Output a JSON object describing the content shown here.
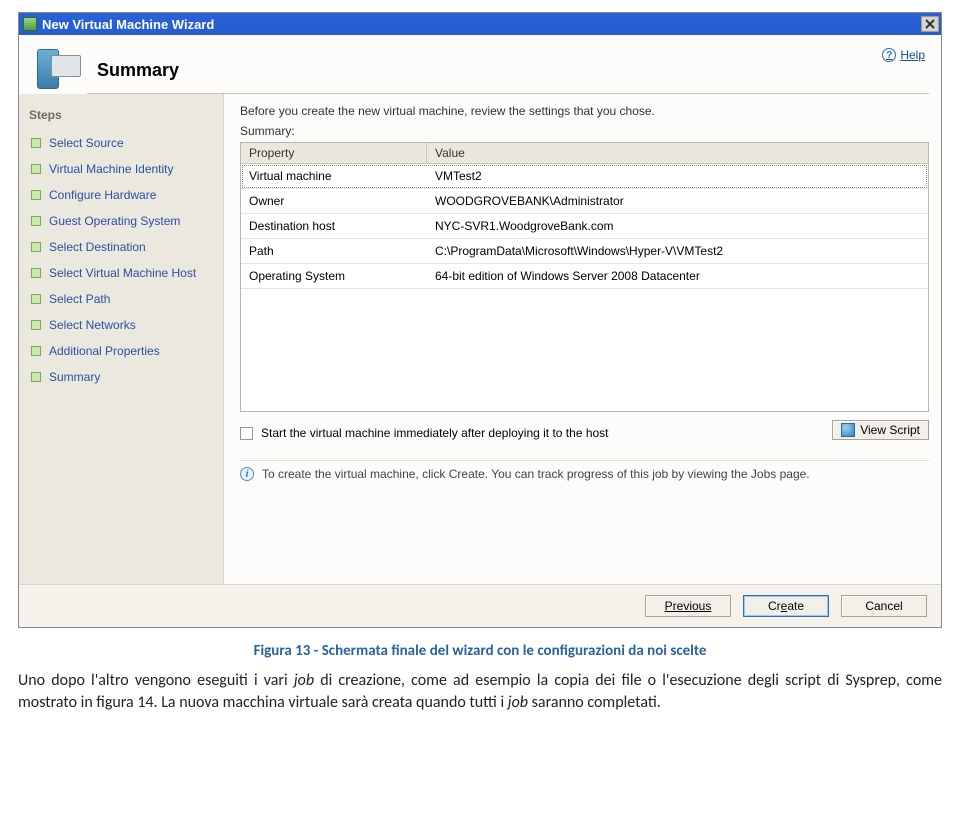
{
  "window": {
    "title": "New Virtual Machine Wizard",
    "help_label": "Help",
    "wizard_title": "Summary"
  },
  "sidebar": {
    "heading": "Steps",
    "items": [
      {
        "label": "Select Source"
      },
      {
        "label": "Virtual Machine Identity"
      },
      {
        "label": "Configure Hardware"
      },
      {
        "label": "Guest Operating System"
      },
      {
        "label": "Select Destination"
      },
      {
        "label": "Select Virtual Machine Host"
      },
      {
        "label": "Select Path"
      },
      {
        "label": "Select Networks"
      },
      {
        "label": "Additional Properties"
      },
      {
        "label": "Summary"
      }
    ]
  },
  "main": {
    "intro": "Before you create the new virtual machine, review the settings that you chose.",
    "summary_label": "Summary:",
    "columns": {
      "property": "Property",
      "value": "Value"
    },
    "rows": [
      {
        "property": "Virtual machine",
        "value": "VMTest2"
      },
      {
        "property": "Owner",
        "value": "WOODGROVEBANK\\Administrator"
      },
      {
        "property": "Destination host",
        "value": "NYC-SVR1.WoodgroveBank.com"
      },
      {
        "property": "Path",
        "value": "C:\\ProgramData\\Microsoft\\Windows\\Hyper-V\\VMTest2"
      },
      {
        "property": "Operating System",
        "value": "64-bit edition of Windows Server 2008 Datacenter"
      }
    ],
    "checkbox_label": "Start the virtual machine immediately after deploying it to the host",
    "view_script_label": "View Script",
    "info_text": "To create the virtual machine, click Create.  You can track progress of this job by viewing the Jobs page."
  },
  "buttons": {
    "previous": "Previous",
    "create_pre": "Cr",
    "create_u": "e",
    "create_post": "ate",
    "cancel": "Cancel"
  },
  "caption": "Figura 13 - Schermata finale del wizard con le configurazioni da noi scelte",
  "paragraph_pre": "Uno dopo l'altro vengono eseguiti i vari ",
  "paragraph_em1": "job",
  "paragraph_mid": " di creazione, come ad esempio la copia dei file o l'esecuzione degli script di Sysprep, come mostrato in figura 14. La nuova macchina virtuale sarà creata quando tutti i ",
  "paragraph_em2": "job",
  "paragraph_post": " saranno completati."
}
